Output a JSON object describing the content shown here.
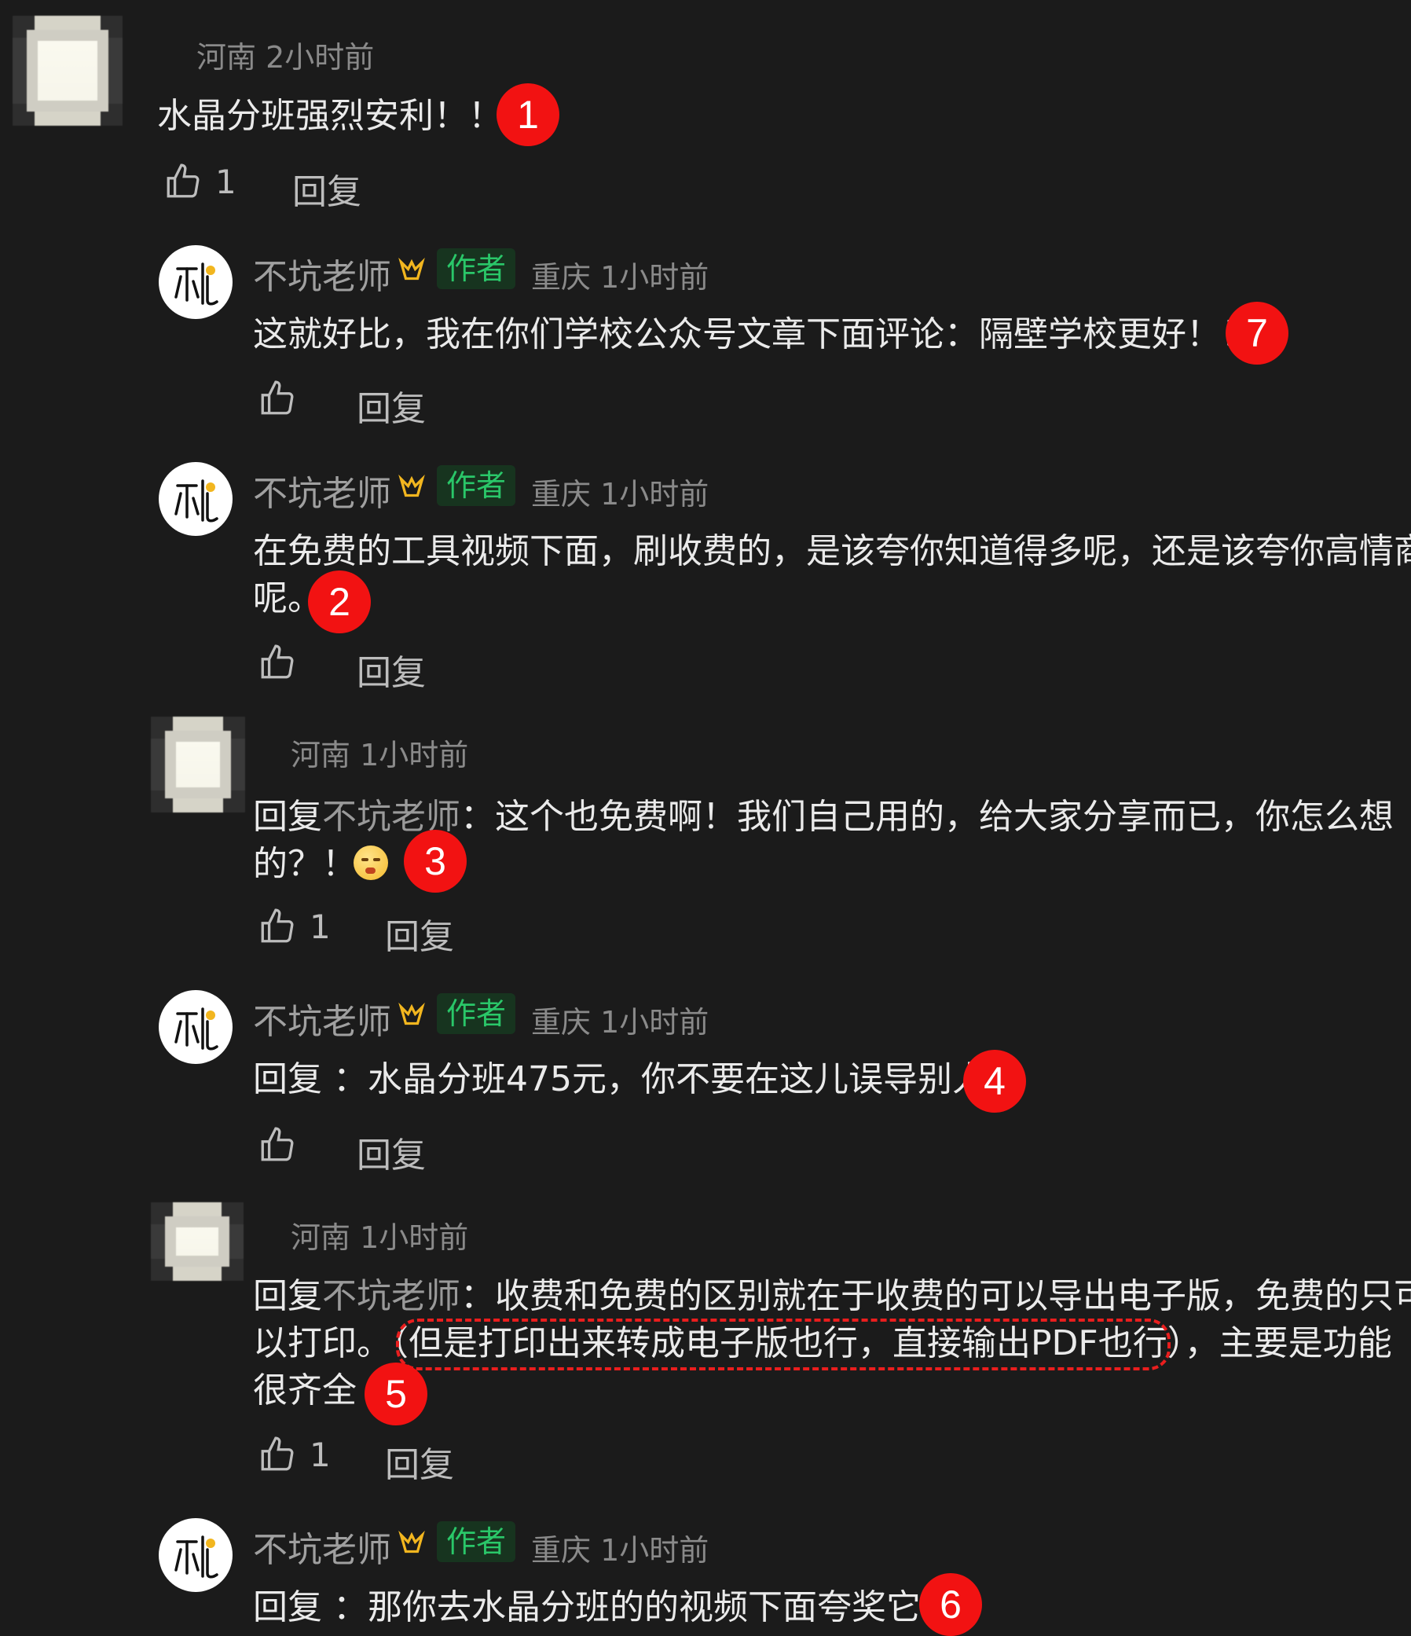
{
  "comments": [
    {
      "location": "河南",
      "time": "2小时前",
      "text": "水晶分班强烈安利！！！",
      "likes": "1",
      "reply": "回复"
    },
    {
      "name": "不坑老师",
      "badge": "作者",
      "location": "重庆",
      "time": "1小时前",
      "text": "这就好比，我在你们学校公众号文章下面评论：隔壁学校更好！！！",
      "reply": "回复"
    },
    {
      "name": "不坑老师",
      "badge": "作者",
      "location": "重庆",
      "time": "1小时前",
      "text_line1": "在免费的工具视频下面，刷收费的，是该夸你知道得多呢，还是该夸你高情商",
      "text_line2": "呢。",
      "reply": "回复"
    },
    {
      "location": "河南",
      "time": "1小时前",
      "reply_prefix": "回复",
      "reply_to": "不坑老师",
      "text_line1": "：这个也免费啊！我们自己用的，给大家分享而已，你怎么想",
      "text_line2": "的？！",
      "likes": "1",
      "reply": "回复"
    },
    {
      "name": "不坑老师",
      "badge": "作者",
      "location": "重庆",
      "time": "1小时前",
      "reply_prefix": "回复",
      "text": "：水晶分班475元，你不要在这儿误导别人",
      "reply": "回复"
    },
    {
      "location": "河南",
      "time": "1小时前",
      "reply_prefix": "回复",
      "reply_to": "不坑老师",
      "text_line1": "：收费和免费的区别就在于收费的可以导出电子版，免费的只可",
      "text_line2a": "以打印。",
      "text_line2b": "（但是打印出来转成电子版也行，直接输出PDF也行）",
      "text_line2c": "，主要是功能",
      "text_line3": "很齐全",
      "likes": "1",
      "reply": "回复"
    },
    {
      "name": "不坑老师",
      "badge": "作者",
      "location": "重庆",
      "time": "1小时前",
      "reply_prefix": "回复",
      "text": "：那你去水晶分班的的视频下面夸奖它。"
    }
  ],
  "markers": [
    "1",
    "7",
    "2",
    "3",
    "4",
    "5",
    "6"
  ],
  "colors": {
    "background": "#1b1b1b",
    "badge_text": "#2ac769",
    "marker": "#f21212",
    "crown": "#f2b61f"
  },
  "icons": {
    "like": "thumbs-up-icon",
    "crown": "creator-crown-icon"
  }
}
